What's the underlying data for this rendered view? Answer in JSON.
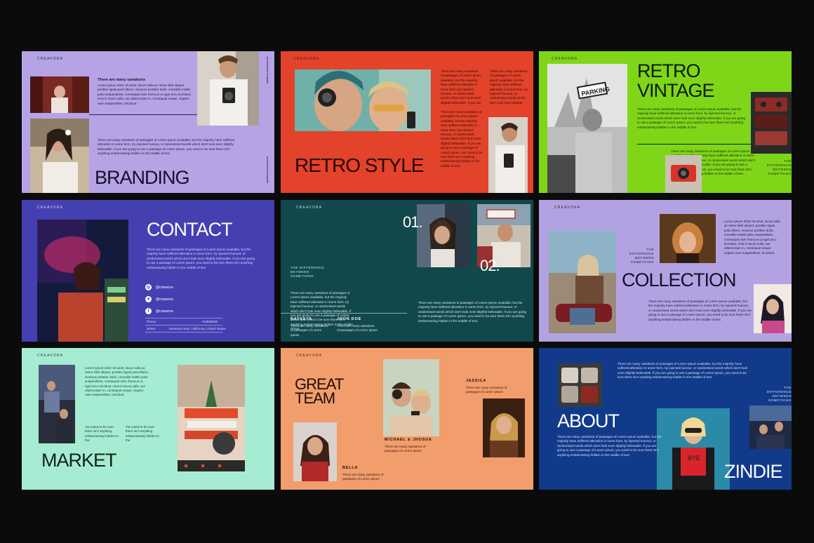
{
  "brand": "CREAVORA",
  "variations_text": "There are many variations of passages of Lorem Ipsum available, but the majority have suffered alteration in some form, by injected humour, or randomised words which don't look even slightly believable. If you are going to use a passage of Lorem Ipsum, you need to be sure there isn't anything embarrassing hidden in the middle of text.",
  "lorem_short": "Lorem ipsum dolor sit amet, lacus nulla ac netus nibh aliquet, porttitor ligula justo libero, vivamus porttitor dolor, convallis mattis justo suspendisse, consequat nam rhoncus ut eget arcu tincidunt, eros in lacus nulla, aut ullamcorper in, consequat neque. Sapien nam suspendisse, tincidunt.",
  "difference": "THE DIFFERENCE BETWEEN SOMETHING",
  "slides": {
    "branding": {
      "title": "BRANDING",
      "subtitle": "There are many variations",
      "vertical": "presentation template"
    },
    "retro_style": {
      "title": "RETRO STYLE"
    },
    "retro_vintage": {
      "title_line1": "RETRO",
      "title_line2": "VINTAGE",
      "sign": "PARKING"
    },
    "contact": {
      "title": "CONTACT",
      "socials": [
        "@creavora",
        "@creavora",
        "@creavora"
      ],
      "phone_label": "Phone",
      "phone_value": "+62888000",
      "street_label": "Street",
      "street_value": "Montreal View, California, United States"
    },
    "numbers": {
      "num1": "01.",
      "num2": "02.",
      "name1": "NATASYA",
      "name2": "JHON DOE",
      "person_text": "There are many variations of passages of Lorem Ipsum"
    },
    "collection": {
      "title": "COLLECTION"
    },
    "market": {
      "title": "MARKET",
      "col_text": "You need to be sure there isn't anything embarrassing hidden in the"
    },
    "great_team": {
      "title_line1": "GREAT",
      "title_line2": "TEAM",
      "member1": "JESSICA",
      "member2": "MICHAEL & JHOSUA",
      "member3": "BELLA",
      "member_text": "There are many variations of passages of Lorem Ipsum"
    },
    "about": {
      "title": "ABOUT",
      "name": "ZINDIE",
      "shirt": "BYE"
    }
  }
}
